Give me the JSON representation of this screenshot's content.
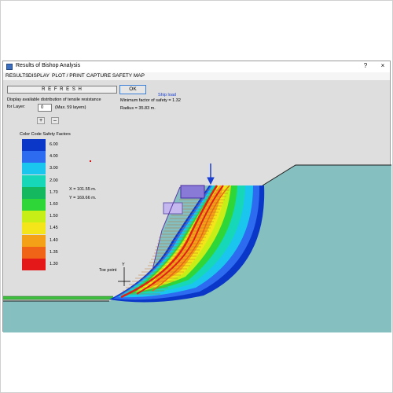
{
  "window": {
    "title": "Results of Bishop Analysis",
    "help_label": "?",
    "close_label": "×"
  },
  "menu": {
    "items": [
      "RESULTS",
      "DISPLAY",
      "PLOT / PRINT",
      "CAPTURE SAFETY MAP"
    ]
  },
  "controls": {
    "refresh_label": "R E F R E S H",
    "ok_label": "OK",
    "display_text": "Display available distribution of tensile resistance",
    "layer_label": "for Layer:",
    "layer_value": "0",
    "layer_max": "(Max. 59 layers)",
    "plus_label": "+",
    "minus_label": "–"
  },
  "results": {
    "min_fs": "Minimum factor of safety = 1.32",
    "radius": "Radius = 35.83 m."
  },
  "legend": {
    "title": "Color Code Safety Factors",
    "items": [
      {
        "label": "6.00",
        "color": "#0a37c8"
      },
      {
        "label": "4.00",
        "color": "#2d6cf0"
      },
      {
        "label": "3.00",
        "color": "#1ac6ee"
      },
      {
        "label": "2.00",
        "color": "#16d8b8"
      },
      {
        "label": "1.70",
        "color": "#14b85e"
      },
      {
        "label": "1.60",
        "color": "#2fd637"
      },
      {
        "label": "1.50",
        "color": "#c8ee18"
      },
      {
        "label": "1.45",
        "color": "#f4e41a"
      },
      {
        "label": "1.40",
        "color": "#f4a118"
      },
      {
        "label": "1.35",
        "color": "#f06418"
      },
      {
        "label": "1.30",
        "color": "#e41818"
      }
    ]
  },
  "coords": {
    "x": "X = 101.55 m.",
    "y": "Y = 169.66 m."
  },
  "labels": {
    "ship_load": "Ship load",
    "toe_point": "Toe point",
    "y_axis": "Y"
  },
  "colors": {
    "ground": "#86bfc0",
    "window_bg": "#dedede",
    "accent_blue": "#1a3fd0"
  }
}
